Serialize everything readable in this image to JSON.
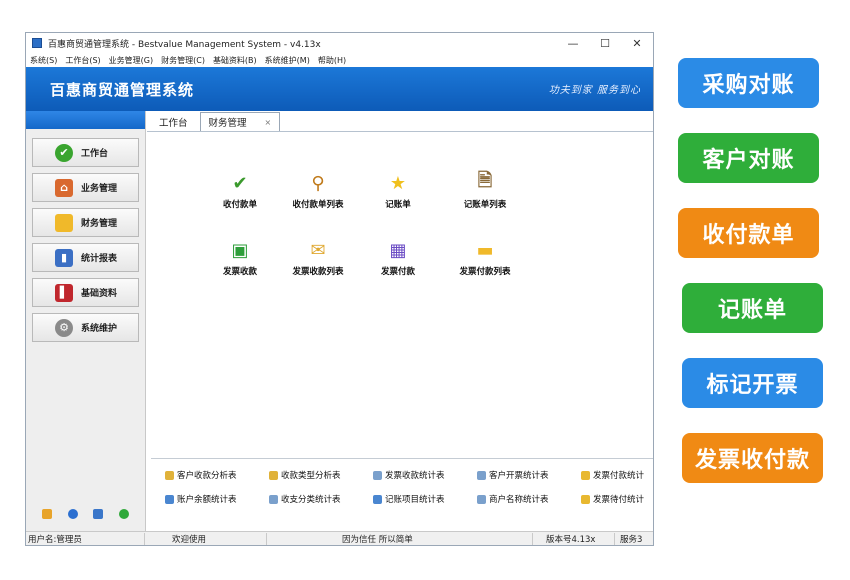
{
  "window": {
    "title": "百惠商贸通管理系统 - Bestvalue Management System - v4.13x",
    "controls": {
      "minimize": "—",
      "maximize": "☐",
      "close": "✕"
    }
  },
  "menu": [
    "系统(S)",
    "工作台(S)",
    "业务管理(G)",
    "财务管理(C)",
    "基础资料(B)",
    "系统维护(M)",
    "帮助(H)"
  ],
  "banner": {
    "title": "百惠商贸通管理系统",
    "slogan": "功夫到家 服务到心"
  },
  "sidebar": {
    "items": [
      {
        "label": "工作台",
        "icon": "check-circle-icon",
        "color": "#3aa52f"
      },
      {
        "label": "业务管理",
        "icon": "house-icon",
        "color": "#d9692f"
      },
      {
        "label": "财务管理",
        "icon": "folder-icon",
        "color": "#f0b92a"
      },
      {
        "label": "统计报表",
        "icon": "bar-chart-icon",
        "color": "#3b6fc4"
      },
      {
        "label": "基础资料",
        "icon": "book-icon",
        "color": "#c0272d"
      },
      {
        "label": "系统维护",
        "icon": "gear-icon",
        "color": "#8a8a8a"
      }
    ]
  },
  "tabs": [
    {
      "label": "工作台"
    },
    {
      "label": "财务管理",
      "close": "×"
    }
  ],
  "functions": [
    {
      "label": "收付款单",
      "icon": "checkmark-icon"
    },
    {
      "label": "收付款单列表",
      "icon": "magnifier-icon"
    },
    {
      "label": "记账单",
      "icon": "star-icon"
    },
    {
      "label": "记账单列表",
      "icon": "document-search-icon"
    },
    {
      "label": "发票收款",
      "icon": "invoice-icon"
    },
    {
      "label": "发票收款列表",
      "icon": "envelope-search-icon"
    },
    {
      "label": "发票付款",
      "icon": "cubes-icon"
    },
    {
      "label": "发票付款列表",
      "icon": "folder-icon"
    }
  ],
  "reports": [
    "客户收款分析表",
    "收款类型分析表",
    "发票收款统计表",
    "客户开票统计表",
    "发票付款统计",
    "账户余额统计表",
    "收支分类统计表",
    "记账项目统计表",
    "商户名称统计表",
    "发票待付统计"
  ],
  "status": {
    "user": "用户名:管理员",
    "welcome": "欢迎使用",
    "motto": "因为信任 所以简单",
    "version": "版本号4.13x",
    "service": "服务3"
  },
  "pills": [
    {
      "label": "采购对账",
      "color": "#2b8be6"
    },
    {
      "label": "客户对账",
      "color": "#2fae3a"
    },
    {
      "label": "收付款单",
      "color": "#f08a14"
    },
    {
      "label": "记账单",
      "color": "#2fae3a"
    },
    {
      "label": "标记开票",
      "color": "#2b8be6"
    },
    {
      "label": "发票收付款",
      "color": "#f08a14"
    }
  ]
}
